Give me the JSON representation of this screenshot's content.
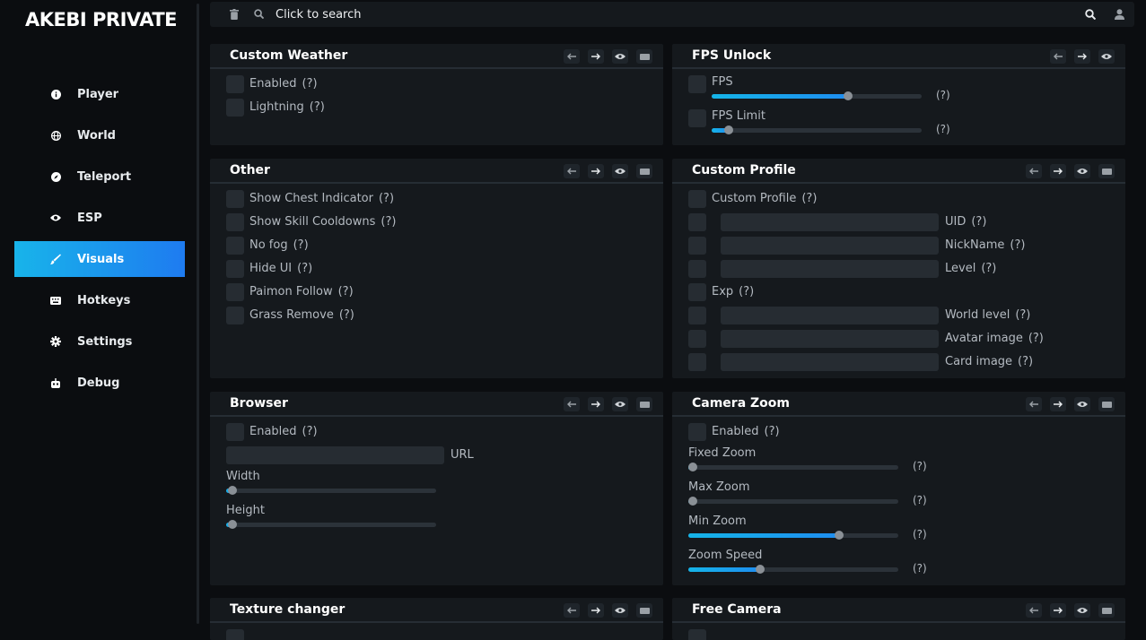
{
  "app_title": "AKEBI PRIVATE",
  "sidebar": {
    "items": [
      {
        "label": "Player"
      },
      {
        "label": "World"
      },
      {
        "label": "Teleport"
      },
      {
        "label": "ESP"
      },
      {
        "label": "Visuals"
      },
      {
        "label": "Hotkeys"
      },
      {
        "label": "Settings"
      },
      {
        "label": "Debug"
      }
    ],
    "active": "Visuals"
  },
  "search": {
    "placeholder": "Click to search"
  },
  "help": "(?)",
  "panels": {
    "custom_weather": {
      "title": "Custom Weather",
      "enabled": "Enabled",
      "lightning": "Lightning"
    },
    "fps_unlock": {
      "title": "FPS Unlock",
      "fps": "FPS",
      "fps_limit": "FPS Limit",
      "fps_value": 0.65,
      "fps_limit_value": 0.08
    },
    "other": {
      "title": "Other",
      "items": [
        "Show Chest Indicator",
        "Show Skill Cooldowns",
        "No fog",
        "Hide UI",
        "Paimon Follow",
        "Grass Remove"
      ]
    },
    "custom_profile": {
      "title": "Custom Profile",
      "toggle": "Custom Profile",
      "uid": "UID",
      "nickname": "NickName",
      "level": "Level",
      "exp": "Exp",
      "world_level": "World level",
      "avatar_image": "Avatar image",
      "card_image": "Card image"
    },
    "browser": {
      "title": "Browser",
      "enabled": "Enabled",
      "url": "URL",
      "width": "Width",
      "height": "Height",
      "width_value": 0.03,
      "height_value": 0.03
    },
    "camera_zoom": {
      "title": "Camera Zoom",
      "enabled": "Enabled",
      "fixed_zoom": "Fixed Zoom",
      "max_zoom": "Max Zoom",
      "min_zoom": "Min Zoom",
      "zoom_speed": "Zoom Speed",
      "fixed_value": 0.0,
      "max_value": 0.02,
      "min_value": 0.72,
      "speed_value": 0.34
    },
    "texture_changer": {
      "title": "Texture changer"
    },
    "free_camera": {
      "title": "Free Camera"
    }
  },
  "colors": {
    "accent_start": "#18b4ea",
    "accent_end": "#1e7bf0",
    "panel_bg": "#15191d",
    "app_bg": "#0b0d10"
  }
}
